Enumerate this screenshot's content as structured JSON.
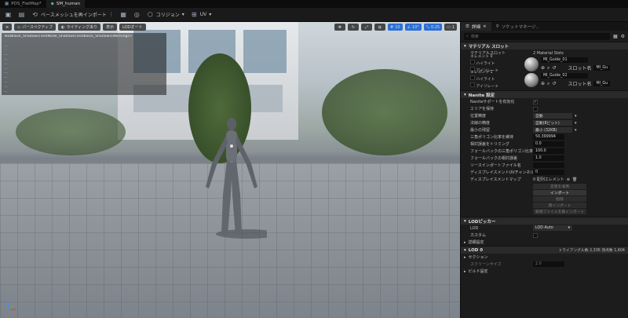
{
  "tabs": [
    {
      "label": "POS_FlatMap*",
      "active": false
    },
    {
      "label": "SM_human",
      "active": true
    }
  ],
  "toolbar": {
    "reimport_label": "ベースメッシュを再インポート",
    "collision_label": "コリジョン",
    "uv_label": "UV"
  },
  "viewport": {
    "perspective_label": "パースペクティブ",
    "lighting_label": "ライティングあり",
    "show_label": "表示",
    "lod_label": "LODオート",
    "right_values": [
      "10",
      "10°",
      "0.25",
      "1"
    ],
    "stats": [
      "TextBlock_Shadows)TextNode_Shadows(TextBlock_Shadows)Warnings>",
      "...",
      "...",
      "...",
      "...",
      "...",
      "...",
      "...",
      "...",
      "...",
      "...",
      "...",
      "..."
    ]
  },
  "panel": {
    "tab_details": "詳細",
    "tab_socket": "ソケットマネージ..",
    "search_placeholder": "検索",
    "material_section": "マテリアル スロット",
    "material_slots_label": "マテリアルスロット",
    "material_slots_value": "2 Material Slots",
    "elements": [
      {
        "label": "エレメント 0",
        "highlight": "ハイライト",
        "isolate": "アイソレート",
        "name": "MI_Guide_01",
        "slot": "スロット名",
        "slot_value": "MI_Gu"
      },
      {
        "label": "エレメント 1",
        "highlight": "ハイライト",
        "isolate": "アイソレート",
        "name": "MI_Guide_02",
        "slot": "スロット名",
        "slot_value": "MI_Gu"
      }
    ],
    "nanite_section": "Nanite 設定",
    "nanite_rows": [
      {
        "label": "Naniteサポートを有効化",
        "type": "check",
        "value": "✓"
      },
      {
        "label": "エリアを保持",
        "type": "check",
        "value": ""
      },
      {
        "label": "位置精度",
        "type": "dd",
        "value": "自動"
      },
      {
        "label": "法線の精度",
        "type": "dd",
        "value": "自動(8ビット)"
      },
      {
        "label": "最小の残留",
        "type": "dd",
        "value": "最小 (32KB)"
      },
      {
        "label": "三角ポリゴン比率を維持",
        "type": "field",
        "value": "50.399994"
      },
      {
        "label": "相対誤差をトリミング",
        "type": "field",
        "value": "0.0"
      },
      {
        "label": "フォールバックの三角ポリゴン比率",
        "type": "field",
        "value": "100.0"
      },
      {
        "label": "フォールバックの相対誤差",
        "type": "field",
        "value": "1.0"
      },
      {
        "label": "ソースインポートファイル名",
        "type": "field",
        "value": ""
      },
      {
        "label": "ディスプレイスメントUVチャンネル",
        "type": "field",
        "value": "0"
      },
      {
        "label": "ディスプレイスメントマップ",
        "type": "text",
        "value": "0 配列エレメント"
      }
    ],
    "nanite_buttons": [
      {
        "label": "変更を適用",
        "on": false
      },
      {
        "label": "インポート",
        "on": true
      },
      {
        "label": "削除",
        "on": false
      },
      {
        "label": "再インポート",
        "on": false
      },
      {
        "label": "新規ファイルを再インポート",
        "on": false
      }
    ],
    "lod_section": "LODピッカー",
    "lod_label": "LOD",
    "lod_value": "LOD Auto",
    "custom_label": "カスタム",
    "detail_settings": "詳細設定",
    "lod0_label": "LOD 0",
    "lod0_stats": "トライアングル数 2,336  頂点数 1,604",
    "section_label": "セクション",
    "screen_size_label": "スクリーンサイズ",
    "screen_size_value": "2.0",
    "build_settings": "ビルド設定"
  }
}
